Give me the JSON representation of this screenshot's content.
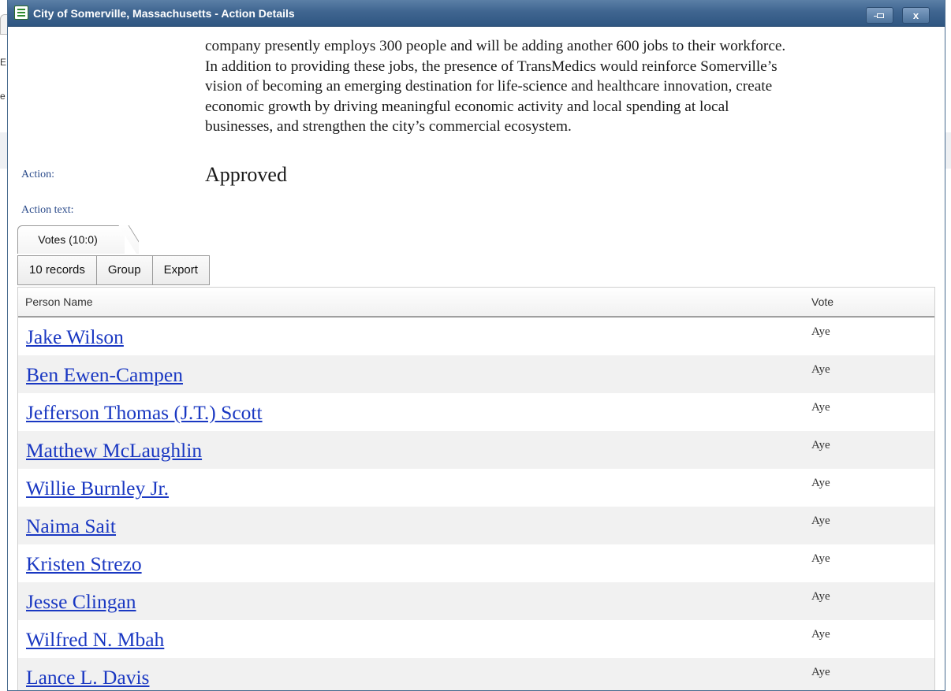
{
  "background": {
    "fragments": [
      "E",
      "e"
    ]
  },
  "window": {
    "title": "City of Somerville, Massachusetts - Action Details",
    "icon": "document-list-icon",
    "pin_icon": "pin-icon",
    "close_label": "x",
    "colors": {
      "titlebar": "#3f6590",
      "link": "#1a38c2"
    }
  },
  "detail": {
    "description_lines": [
      "company presently employs 300 people and will be adding another 600 jobs to their workforce.",
      "In addition to providing these jobs, the presence of TransMedics would reinforce Somerville’s",
      "vision of becoming an emerging destination for life-science and healthcare innovation, create",
      "economic growth by driving meaningful economic activity and local spending at local",
      "businesses, and strengthen the city’s commercial ecosystem."
    ],
    "action_label": "Action:",
    "action_value": "Approved",
    "action_text_label": "Action text:"
  },
  "tabs": [
    {
      "label": "Votes (10:0)"
    }
  ],
  "toolbar": {
    "records_label": "10 records",
    "group_label": "Group",
    "export_label": "Export"
  },
  "grid": {
    "columns": [
      "Person Name",
      "Vote"
    ],
    "rows": [
      {
        "name": "Jake Wilson",
        "vote": "Aye"
      },
      {
        "name": "Ben Ewen-Campen",
        "vote": "Aye"
      },
      {
        "name": "Jefferson Thomas (J.T.) Scott",
        "vote": "Aye"
      },
      {
        "name": "Matthew McLaughlin",
        "vote": "Aye"
      },
      {
        "name": "Willie Burnley Jr.",
        "vote": "Aye"
      },
      {
        "name": "Naima Sait",
        "vote": "Aye"
      },
      {
        "name": "Kristen Strezo",
        "vote": "Aye"
      },
      {
        "name": "Jesse Clingan",
        "vote": "Aye"
      },
      {
        "name": "Wilfred N. Mbah",
        "vote": "Aye"
      },
      {
        "name": "Lance L. Davis",
        "vote": "Aye"
      }
    ]
  }
}
